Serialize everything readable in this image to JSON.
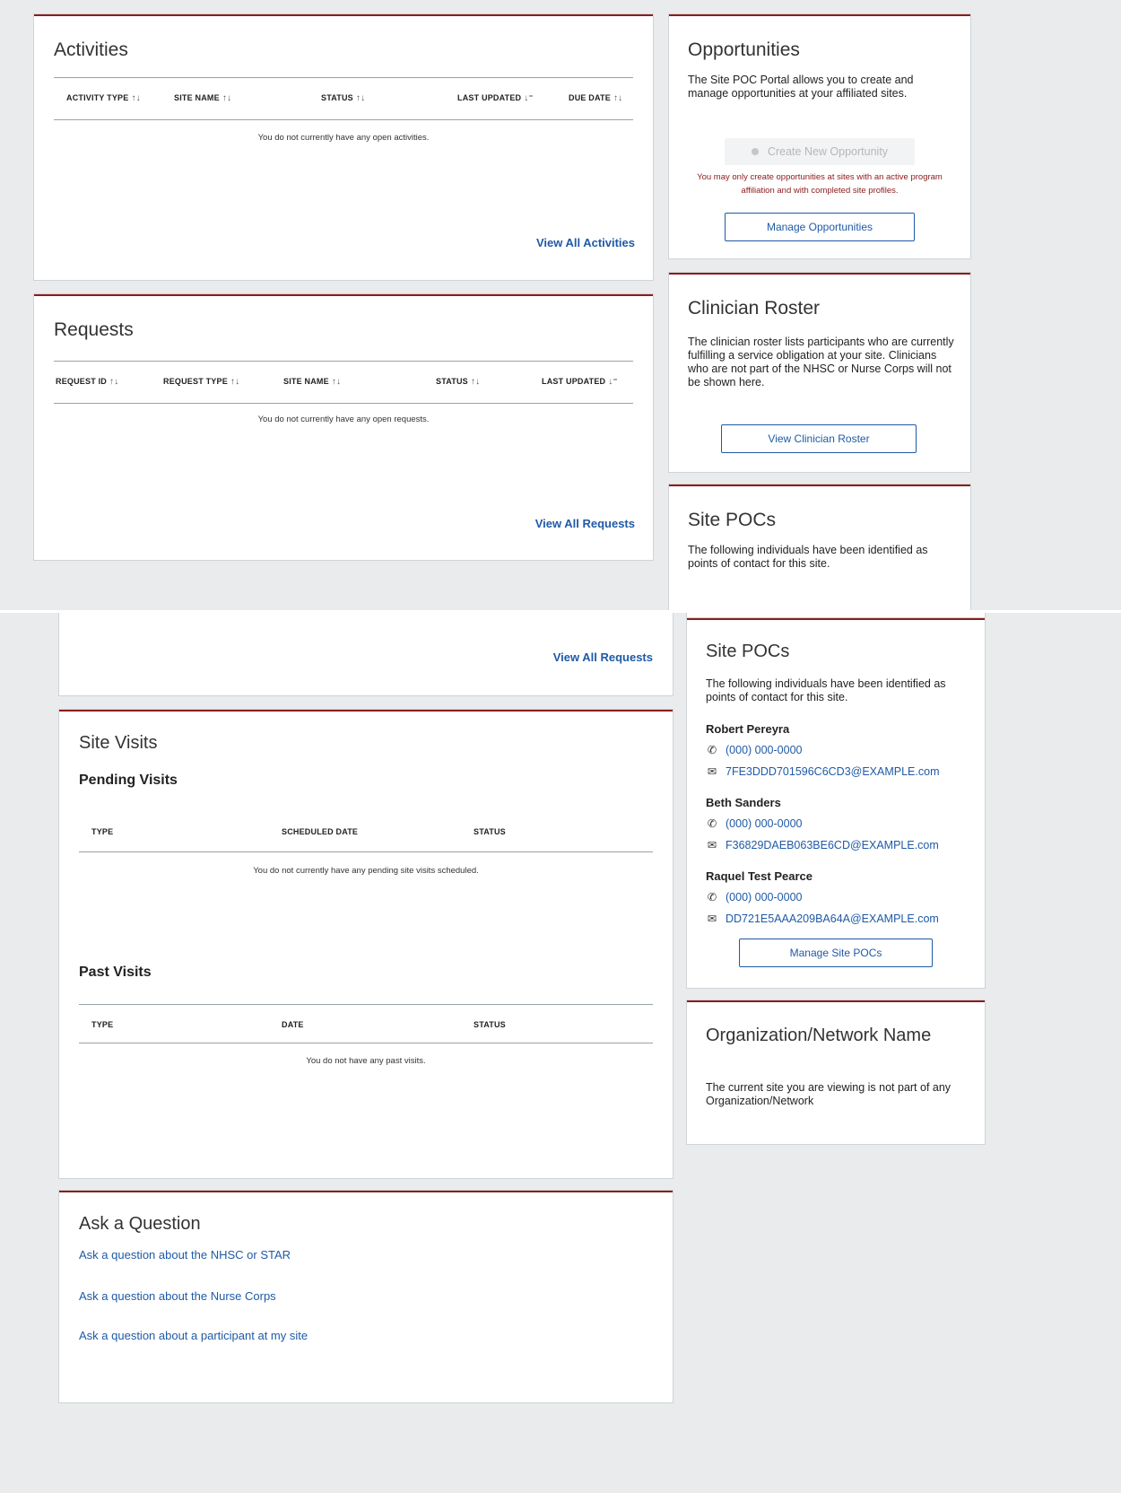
{
  "activities": {
    "title": "Activities",
    "columns": [
      "ACTIVITY TYPE",
      "SITE NAME",
      "STATUS",
      "LAST UPDATED",
      "DUE DATE"
    ],
    "empty_text": "You do not currently have any open activities.",
    "view_all": "View All Activities"
  },
  "requests": {
    "title": "Requests",
    "columns": [
      "REQUEST ID",
      "REQUEST TYPE",
      "SITE NAME",
      "STATUS",
      "LAST UPDATED"
    ],
    "empty_text": "You do not currently have any open requests.",
    "view_all": "View All Requests"
  },
  "opportunities": {
    "title": "Opportunities",
    "description": "The Site POC Portal allows you to create and manage opportunities at your affiliated sites.",
    "create_button": "Create New Opportunity",
    "warning": "You may only create opportunities at sites with an active program affiliation and with completed site profiles.",
    "manage_button": "Manage Opportunities"
  },
  "roster": {
    "title": "Clinician Roster",
    "description": "The clinician roster lists participants who are currently fulfilling a service obligation at your site. Clinicians who are not part of the NHSC or Nurse Corps will not be shown here.",
    "button": "View Clinician Roster"
  },
  "site_pocs": {
    "title": "Site POCs",
    "description": "The following individuals have been identified as points of contact for this site.",
    "contacts": [
      {
        "name": "Robert Pereyra",
        "phone": "(000) 000-0000",
        "email": "7FE3DDD701596C6CD3@EXAMPLE.com"
      },
      {
        "name": "Beth Sanders",
        "phone": "(000) 000-0000",
        "email": "F36829DAEB063BE6CD@EXAMPLE.com"
      },
      {
        "name": "Raquel Test Pearce",
        "phone": "(000) 000-0000",
        "email": "DD721E5AAA209BA64A@EXAMPLE.com"
      }
    ],
    "manage_button": "Manage Site POCs"
  },
  "site_visits": {
    "title": "Site Visits",
    "pending_title": "Pending Visits",
    "pending_columns": [
      "TYPE",
      "SCHEDULED DATE",
      "STATUS"
    ],
    "pending_empty": "You do not currently have any pending site visits scheduled.",
    "past_title": "Past Visits",
    "past_columns": [
      "TYPE",
      "DATE",
      "STATUS"
    ],
    "past_empty": "You do not have any past visits."
  },
  "organization": {
    "title": "Organization/Network Name",
    "description": "The current site you are viewing is not part of any Organization/Network"
  },
  "ask": {
    "title": "Ask a Question",
    "links": [
      "Ask a question about the NHSC or STAR",
      "Ask a question about the Nurse Corps",
      "Ask a question about a participant at my site"
    ]
  },
  "icons": {
    "sort": "sort-arrows-icon",
    "phone": "phone-icon",
    "email": "envelope-icon",
    "add": "plus-circle-icon"
  },
  "colors": {
    "accent_border": "#8c1c1c",
    "link": "#1f5aa6",
    "warning": "#8b1a1a",
    "page_bg": "#e9ebec"
  }
}
